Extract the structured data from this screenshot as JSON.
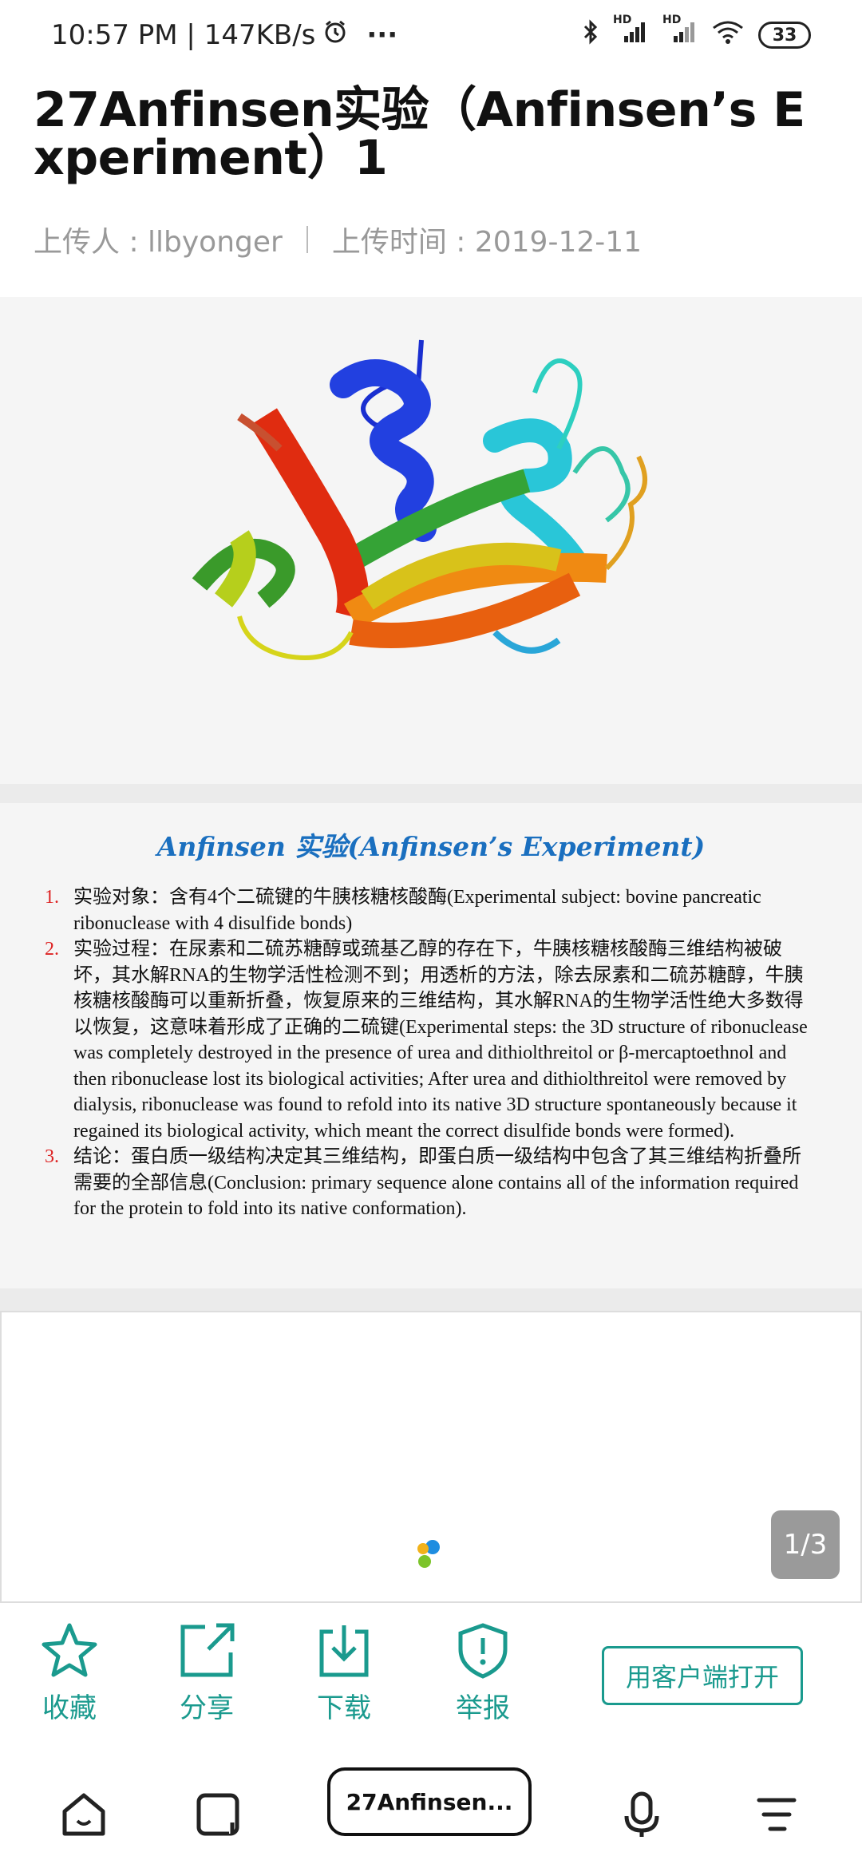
{
  "status": {
    "time_speed": "10:57 PM | 147KB/s",
    "more": "···",
    "hd1": "HD",
    "hd2": "HD",
    "battery": "33"
  },
  "document": {
    "title": "27Anfinsen实验（Anfinsen’s Experiment）1",
    "uploader": "上传人 : llbyonger",
    "upload_time": "上传时间 : 2019-12-11"
  },
  "slide": {
    "title": "Anfinsen 实验(Anfinsen’s Experiment)",
    "items": [
      {
        "num": "1.",
        "text": "实验对象：含有4个二硫键的牛胰核糖核酸酶(Experimental subject: bovine pancreatic ribonuclease with 4 disulfide bonds)"
      },
      {
        "num": "2.",
        "text": "实验过程：在尿素和二硫苏糖醇或巯基乙醇的存在下，牛胰核糖核酸酶三维结构被破坏，其水解RNA的生物学活性检测不到；用透析的方法，除去尿素和二硫苏糖醇，牛胰核糖核酸酶可以重新折叠，恢复原来的三维结构，其水解RNA的生物学活性绝大多数得以恢复，这意味着形成了正确的二硫键(Experimental steps: the 3D structure of ribonuclease was completely destroyed in the presence of urea and dithiolthreitol or β-mercaptoethnol and then ribonuclease lost its biological activities; After urea and dithiolthreitol were removed by dialysis, ribonuclease was found to refold into its native 3D structure spontaneously because it regained its biological activity, which meant the correct disulfide bonds were formed)."
      },
      {
        "num": "3.",
        "text": "结论：蛋白质一级结构决定其三维结构，即蛋白质一级结构中包含了其三维结构折叠所需要的全部信息(Conclusion: primary sequence alone contains all of the information required for the protein to fold into its native conformation)."
      }
    ]
  },
  "viewer": {
    "page_indicator": "1/3"
  },
  "actions": {
    "collect": "收藏",
    "share": "分享",
    "download": "下载",
    "report": "举报",
    "open_app": "用客户端打开"
  },
  "nav": {
    "tab_title": "27Anfinsen..."
  },
  "colors": {
    "accent": "#1a9a8e",
    "slide_title": "#1a6fbf",
    "list_number": "#dd2222"
  }
}
